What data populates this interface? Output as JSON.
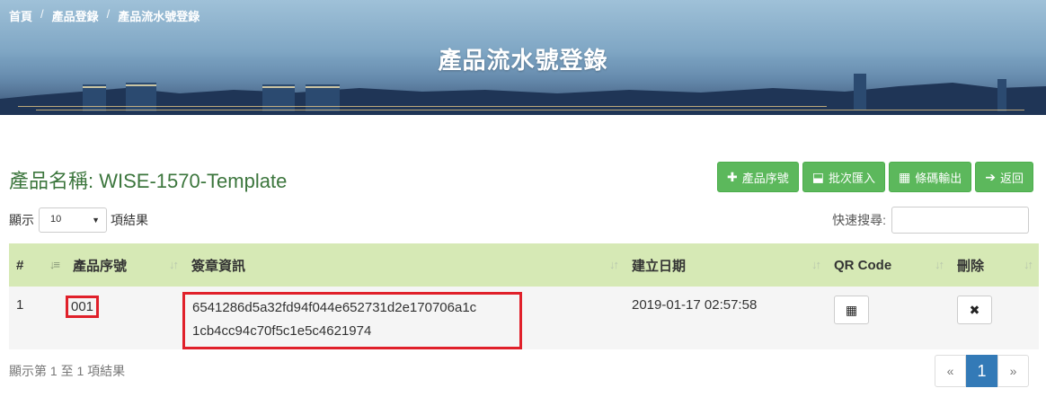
{
  "breadcrumb": {
    "home": "首頁",
    "product_reg": "產品登錄",
    "current": "產品流水號登錄",
    "separator": "/"
  },
  "banner": {
    "title": "產品流水號登錄"
  },
  "product": {
    "label": "產品名稱: ",
    "name": "WISE-1570-Template"
  },
  "toolbar": {
    "add_serial": "產品序號",
    "add_icon": "plus-icon",
    "batch_import": "批次匯入",
    "import_icon": "upload-icon",
    "barcode_export": "條碼輸出",
    "barcode_icon": "qrcode-icon",
    "back": "返回",
    "back_icon": "arrow-right-icon"
  },
  "length": {
    "prefix": "顯示",
    "value": "10",
    "suffix": "項結果"
  },
  "search": {
    "label": "快速搜尋:",
    "value": ""
  },
  "table": {
    "headers": [
      "#",
      "產品序號",
      "簽章資訊",
      "建立日期",
      "QR Code",
      "刪除"
    ],
    "rows": [
      {
        "index": "1",
        "serial": "001",
        "signature_line1": "6541286d5a32fd94f044e652731d2e170706a1c",
        "signature_line2": "1cb4cc94c70f5c1e5c4621974",
        "created": "2019-01-17 02:57:58"
      }
    ]
  },
  "info": "顯示第 1 至 1 項結果",
  "pager": {
    "prev": "«",
    "current": "1",
    "next": "»"
  },
  "colors": {
    "header_bg": "#d6e9b5",
    "btn_green": "#5cb85c",
    "highlight": "#e0202a",
    "pager_active": "#337ab7",
    "heading_green": "#3c763d"
  }
}
